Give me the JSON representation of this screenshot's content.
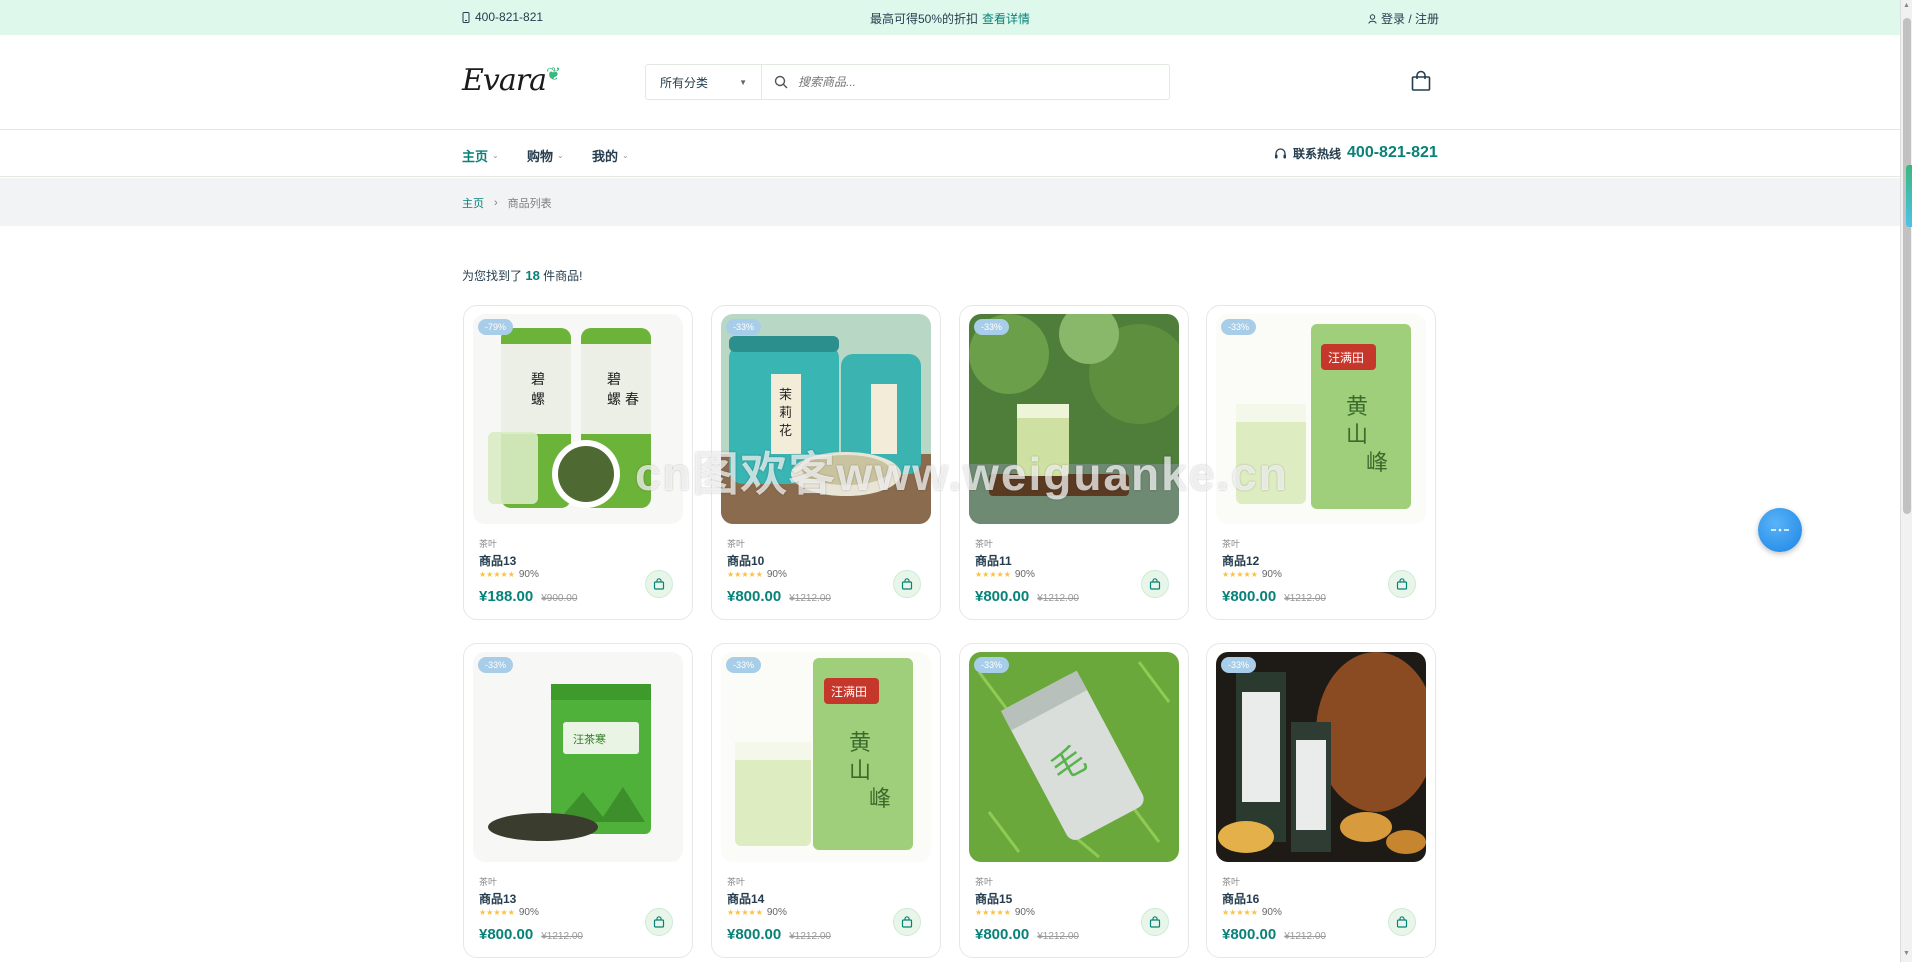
{
  "topbar": {
    "phone": "400-821-821",
    "promo_text": "最高可得50%的折扣",
    "promo_link": "查看详情",
    "auth": "登录 / 注册"
  },
  "header": {
    "logo": "Evara",
    "category_select": "所有分类",
    "search_placeholder": "搜索商品..."
  },
  "nav": {
    "items": [
      {
        "label": "主页"
      },
      {
        "label": "购物"
      },
      {
        "label": "我的"
      }
    ],
    "hotline_label": "联系热线",
    "hotline_number": "400-821-821"
  },
  "breadcrumb": {
    "home": "主页",
    "current": "商品列表"
  },
  "results": {
    "prefix": "为您找到了",
    "count": "18",
    "suffix": "件商品!"
  },
  "watermark": "cn图欢客www.weiguanke.cn",
  "products": [
    {
      "badge": "-79%",
      "category": "茶叶",
      "name": "商品13",
      "rating": "90%",
      "price": "¥188.00",
      "old_price": "¥900.00",
      "image": "tea-cans-green"
    },
    {
      "badge": "-33%",
      "category": "茶叶",
      "name": "商品10",
      "rating": "90%",
      "price": "¥800.00",
      "old_price": "¥1212.00",
      "image": "jasmine-tea-jars"
    },
    {
      "badge": "-33%",
      "category": "茶叶",
      "name": "商品11",
      "rating": "90%",
      "price": "¥800.00",
      "old_price": "¥1212.00",
      "image": "tea-glass-leaves"
    },
    {
      "badge": "-33%",
      "category": "茶叶",
      "name": "商品12",
      "rating": "90%",
      "price": "¥800.00",
      "old_price": "¥1212.00",
      "image": "maofeng-bag"
    },
    {
      "badge": "-33%",
      "category": "茶叶",
      "name": "商品13",
      "rating": "90%",
      "price": "¥800.00",
      "old_price": "¥1212.00",
      "image": "green-tin-box"
    },
    {
      "badge": "-33%",
      "category": "茶叶",
      "name": "商品14",
      "rating": "90%",
      "price": "¥800.00",
      "old_price": "¥1212.00",
      "image": "maofeng-bag-2"
    },
    {
      "badge": "-33%",
      "category": "茶叶",
      "name": "商品15",
      "rating": "90%",
      "price": "¥800.00",
      "old_price": "¥1212.00",
      "image": "silver-can-leaves"
    },
    {
      "badge": "-33%",
      "category": "茶叶",
      "name": "商品16",
      "rating": "90%",
      "price": "¥800.00",
      "old_price": "¥1212.00",
      "image": "tea-boxes-cups"
    }
  ],
  "colors": {
    "accent": "#088178",
    "topbar_bg": "#def9ec",
    "badge": "#a8cde8",
    "star": "#fdc040"
  }
}
